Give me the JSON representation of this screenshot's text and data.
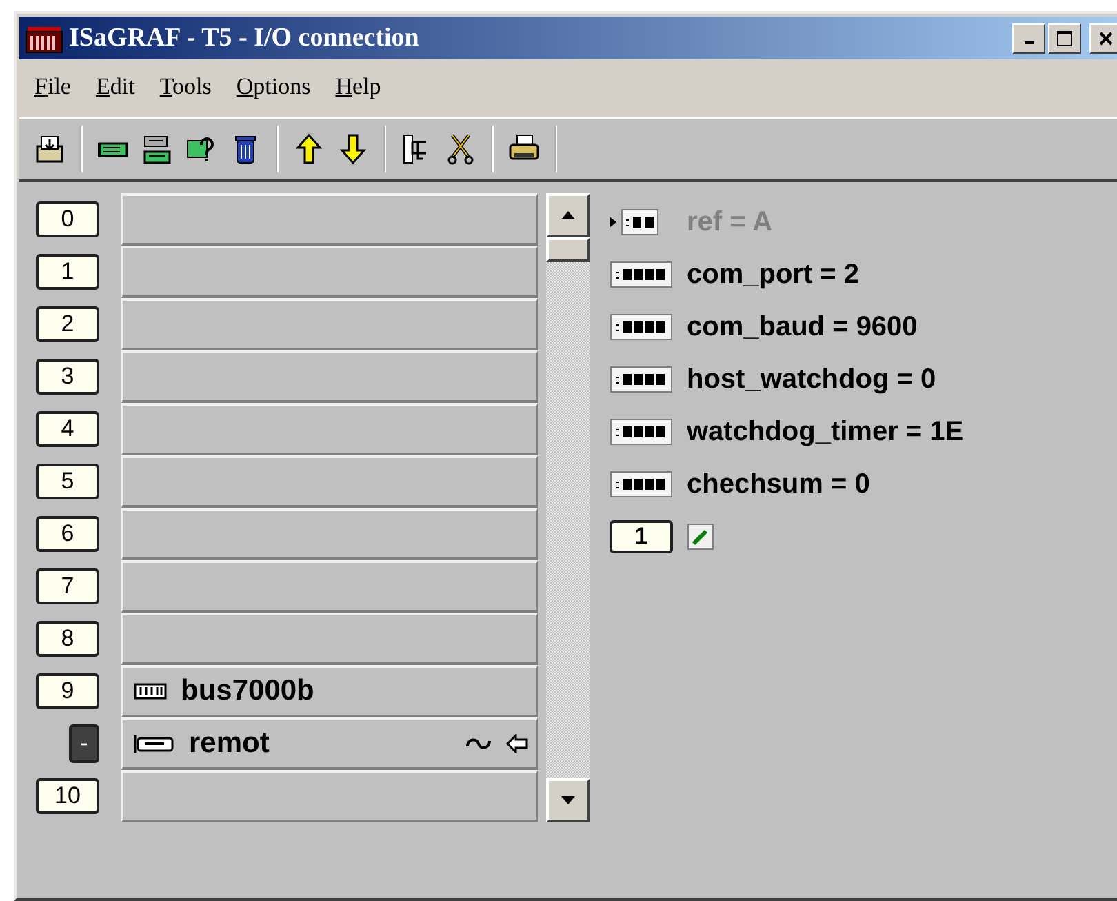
{
  "window": {
    "title": "ISaGRAF - T5 - I/O connection"
  },
  "menu": [
    {
      "label": "File"
    },
    {
      "label": "Edit"
    },
    {
      "label": "Tools"
    },
    {
      "label": "Options"
    },
    {
      "label": "Help"
    }
  ],
  "toolbar": [
    [
      {
        "kind": "import"
      }
    ],
    [
      {
        "kind": "board"
      },
      {
        "kind": "boards"
      },
      {
        "kind": "check"
      },
      {
        "kind": "delete"
      }
    ],
    [
      {
        "kind": "up"
      },
      {
        "kind": "down"
      }
    ],
    [
      {
        "kind": "tree"
      },
      {
        "kind": "cut"
      }
    ],
    [
      {
        "kind": "print"
      }
    ]
  ],
  "slots": [
    {
      "number": "0",
      "kind": "empty"
    },
    {
      "number": "1",
      "kind": "empty"
    },
    {
      "number": "2",
      "kind": "empty"
    },
    {
      "number": "3",
      "kind": "empty"
    },
    {
      "number": "4",
      "kind": "empty"
    },
    {
      "number": "5",
      "kind": "empty"
    },
    {
      "number": "6",
      "kind": "empty"
    },
    {
      "number": "7",
      "kind": "empty"
    },
    {
      "number": "8",
      "kind": "empty"
    },
    {
      "number": "9",
      "kind": "board",
      "name": "bus7000b"
    },
    {
      "number": "-",
      "kind": "equipment",
      "name": "remot"
    },
    {
      "number": "10",
      "kind": "empty"
    }
  ],
  "parameters": [
    {
      "text": "ref = A",
      "kind": "reference",
      "disabled": true
    },
    {
      "text": "com_port = 2",
      "kind": "value",
      "disabled": false
    },
    {
      "text": "com_baud = 9600",
      "kind": "value",
      "disabled": false
    },
    {
      "text": "host_watchdog = 0",
      "kind": "value",
      "disabled": false
    },
    {
      "text": "watchdog_timer = 1E",
      "kind": "value",
      "disabled": false
    },
    {
      "text": "chechsum = 0",
      "kind": "value",
      "disabled": false
    }
  ],
  "channel": {
    "number": "1"
  }
}
